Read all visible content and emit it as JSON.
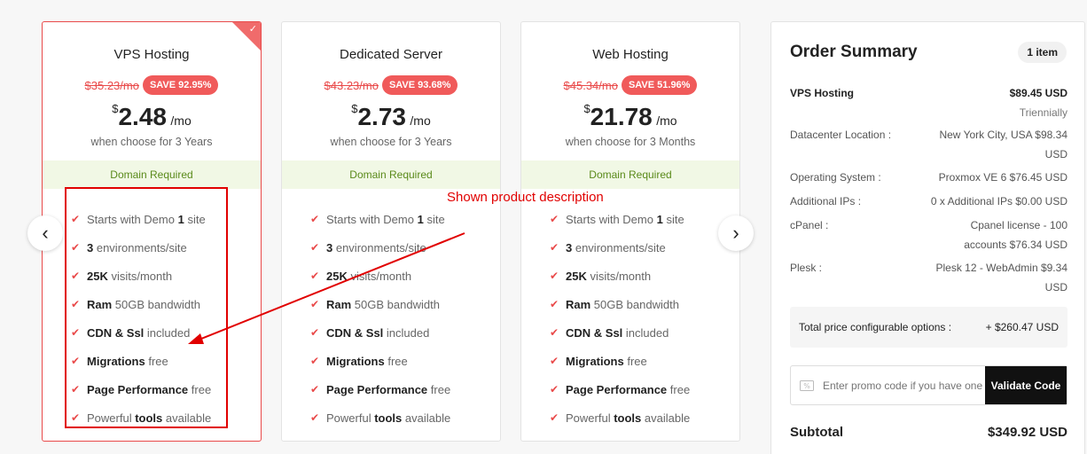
{
  "plans": [
    {
      "title": "VPS Hosting",
      "old_price": "$35.23/mo",
      "save": "SAVE 92.95%",
      "currency": "$",
      "price": "2.48",
      "period": "/mo",
      "term": "when choose for 3 Years",
      "domain": "Domain Required",
      "selected": true
    },
    {
      "title": "Dedicated Server",
      "old_price": "$43.23/mo",
      "save": "SAVE 93.68%",
      "currency": "$",
      "price": "2.73",
      "period": "/mo",
      "term": "when choose for 3 Years",
      "domain": "Domain Required",
      "selected": false
    },
    {
      "title": "Web Hosting",
      "old_price": "$45.34/mo",
      "save": "SAVE 51.96%",
      "currency": "$",
      "price": "21.78",
      "period": "/mo",
      "term": "when choose for 3 Months",
      "domain": "Domain Required",
      "selected": false
    }
  ],
  "features": [
    {
      "pre": "Starts with Demo ",
      "bold": "1",
      "post": " site"
    },
    {
      "pre": "",
      "bold": "3",
      "post": " environments/site"
    },
    {
      "pre": "",
      "bold": "25K",
      "post": " visits/month"
    },
    {
      "pre": "",
      "bold": "Ram",
      "post": " 50GB bandwidth"
    },
    {
      "pre": "",
      "bold": "CDN & Ssl",
      "post": " included"
    },
    {
      "pre": "",
      "bold": "Migrations",
      "post": " free"
    },
    {
      "pre": "",
      "bold": "Page Performance",
      "post": " free"
    },
    {
      "pre": "Powerful ",
      "bold": "tools",
      "post": " available"
    }
  ],
  "icons": {
    "check": "✔",
    "prev": "‹",
    "next": "›",
    "corner_check": "✓",
    "promo": "%"
  },
  "annotation": {
    "label": "Shown product description",
    "color": "#e10000"
  },
  "summary": {
    "title": "Order Summary",
    "count": "1 item",
    "product_label": "VPS Hosting",
    "product_price": "$89.45 USD",
    "product_cycle": "Triennially",
    "rows": [
      {
        "label": "Datacenter Location :",
        "value": "New York City, USA $98.34 USD"
      },
      {
        "label": "Operating System :",
        "value": "Proxmox VE 6 $76.45 USD"
      },
      {
        "label": "Additional IPs :",
        "value": "0 x Additional IPs $0.00 USD"
      },
      {
        "label": "cPanel :",
        "value": "Cpanel license - 100 accounts $76.34 USD"
      },
      {
        "label": "Plesk :",
        "value": "Plesk 12 - WebAdmin $9.34 USD"
      }
    ],
    "total_label": "Total price configurable options :",
    "total_value": "+ $260.47 USD",
    "promo_placeholder": "Enter promo code if you have one",
    "validate_label": "Validate Code",
    "subtotal_label": "Subtotal",
    "subtotal_value": "$349.92 USD"
  },
  "colors": {
    "accent": "#e94a4a",
    "domain_bg": "#f1f8e5",
    "domain_text": "#5a8a1a"
  }
}
